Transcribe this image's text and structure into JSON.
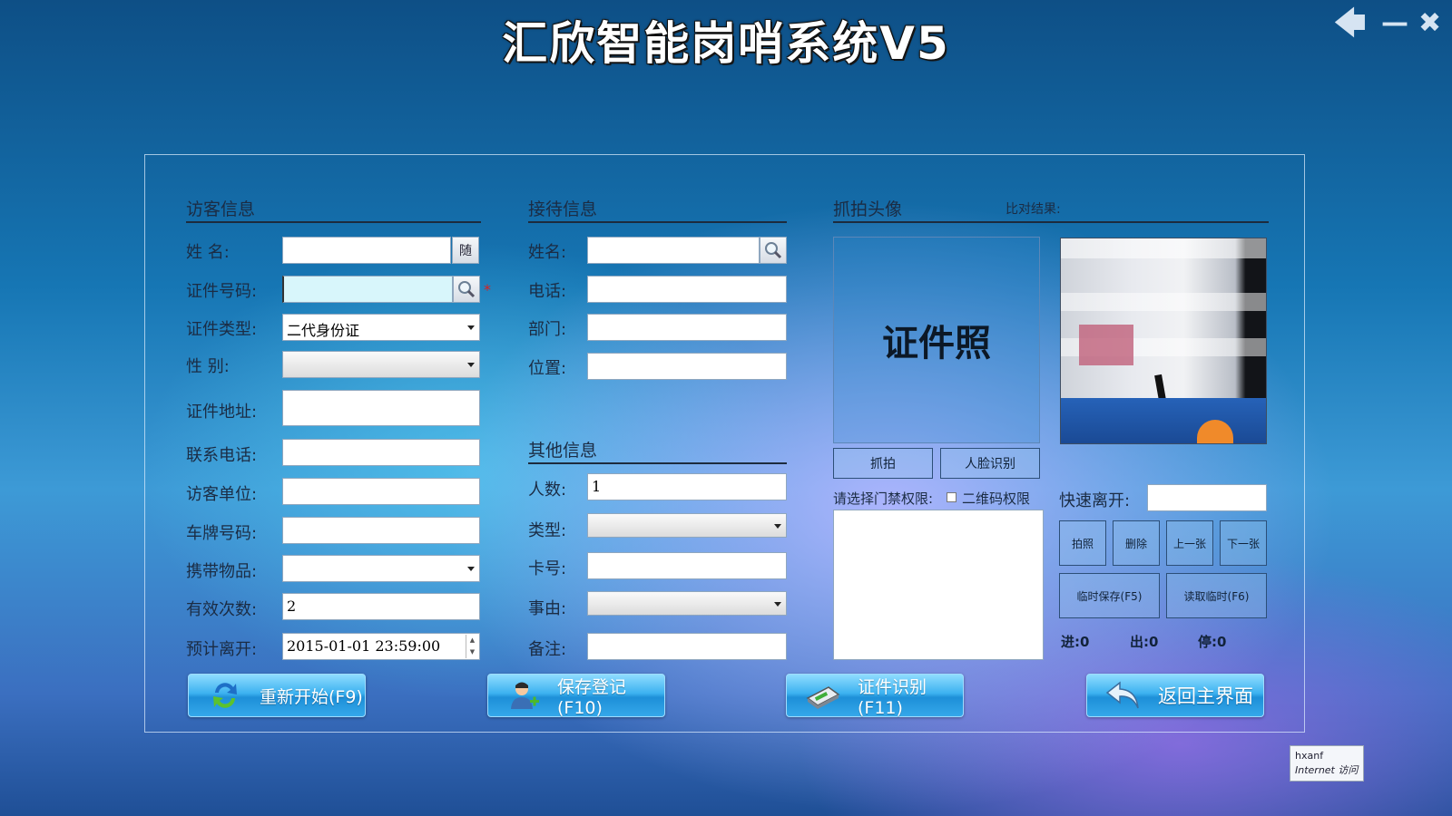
{
  "app": {
    "title": "汇欣智能岗哨系统V5",
    "window_controls": {
      "back": "🡄",
      "minimize": "—",
      "close": "✖"
    }
  },
  "visitor": {
    "section_title": "访客信息",
    "name_label": "姓    名:",
    "name_value": "",
    "random_button": "随",
    "id_number_label": "证件号码:",
    "id_number_value": "",
    "required_mark": "*",
    "id_type_label": "证件类型:",
    "id_type_value": "二代身份证",
    "gender_label": "性    别:",
    "gender_value": "",
    "address_label": "证件地址:",
    "address_value": "",
    "phone_label": "联系电话:",
    "phone_value": "",
    "company_label": "访客单位:",
    "company_value": "",
    "plate_label": "车牌号码:",
    "plate_value": "",
    "items_label": "携带物品:",
    "items_value": "",
    "valid_times_label": "有效次数:",
    "valid_times_value": "2",
    "leave_label": "预计离开:",
    "leave_value": "2015-01-01 23:59:00"
  },
  "reception": {
    "section_title": "接待信息",
    "name_label": "姓名:",
    "name_value": "",
    "phone_label": "电话:",
    "phone_value": "",
    "dept_label": "部门:",
    "dept_value": "",
    "position_label": "位置:",
    "position_value": ""
  },
  "other": {
    "section_title": "其他信息",
    "count_label": "人数:",
    "count_value": "1",
    "type_label": "类型:",
    "type_value": "",
    "card_label": "卡号:",
    "card_value": "",
    "reason_label": "事由:",
    "reason_value": "",
    "remark_label": "备注:",
    "remark_value": ""
  },
  "capture": {
    "section_title": "抓拍头像",
    "compare_label": "比对结果:",
    "id_photo_text": "证件照",
    "snap_button": "抓拍",
    "face_button": "人脸识别",
    "access_label": "请选择门禁权限:",
    "qr_label": "二维码权限",
    "quick_leave_label": "快速离开:",
    "quick_leave_value": "",
    "photo_button": "拍照",
    "delete_button": "删除",
    "prev_button": "上一张",
    "next_button": "下一张",
    "temp_save_button": "临时保存(F5)",
    "read_temp_button": "读取临时(F6)",
    "in_count": "进:0",
    "out_count": "出:0",
    "stop_count": "停:0"
  },
  "actions": {
    "restart": "重新开始(F9)",
    "save": "保存登记(F10)",
    "id_recognize": "证件识别(F11)",
    "home": "返回主界面"
  },
  "tooltip": {
    "line1": "hxanf",
    "line2": "Internet 访问"
  }
}
